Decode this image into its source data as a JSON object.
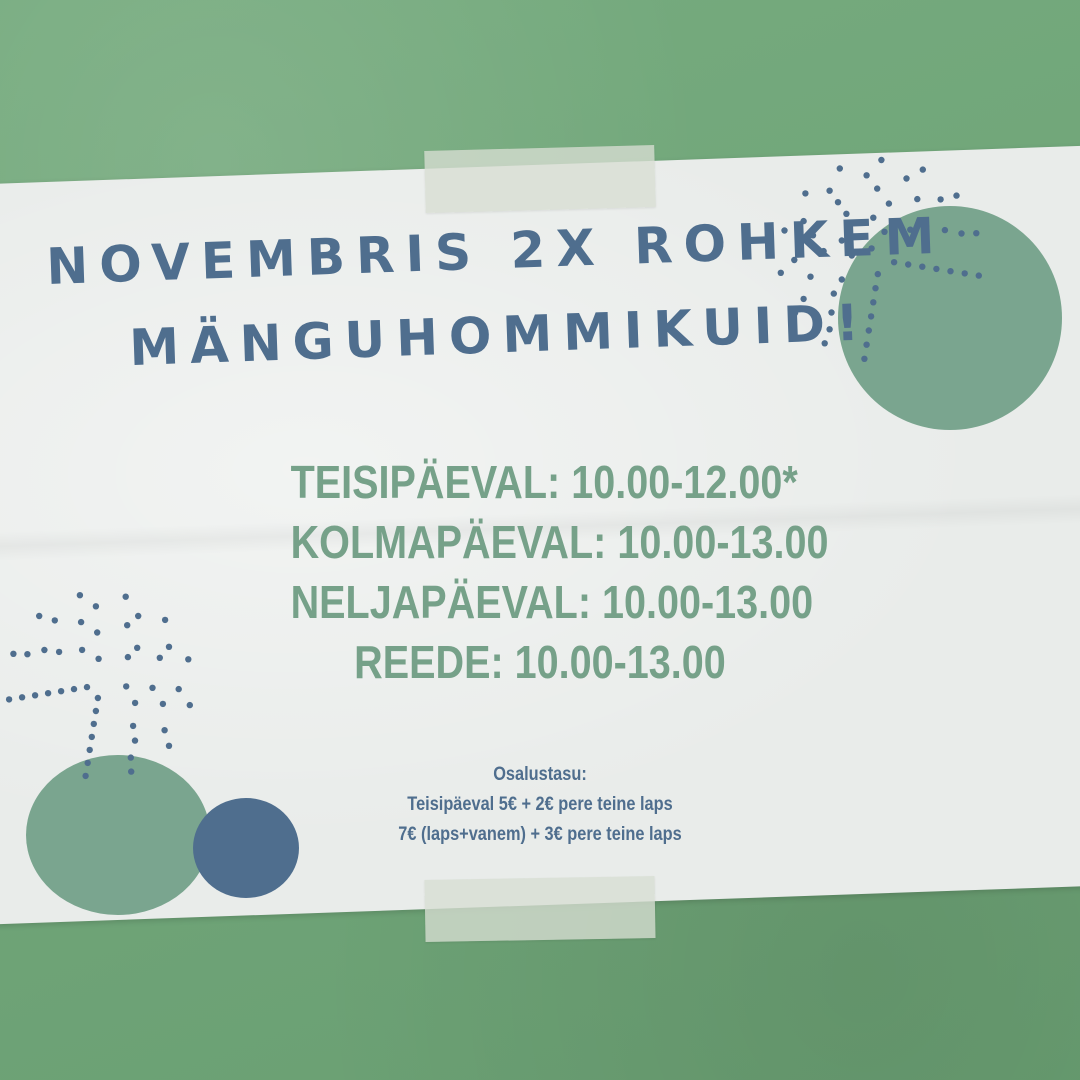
{
  "title": {
    "line1": "NOVEMBRIS 2X ROHKEM",
    "line2": "MÄNGUHOMMIKUID!"
  },
  "schedule": [
    "TEISIPÄEVAL: 10.00-12.00*",
    "KOLMAPÄEVAL: 10.00-13.00",
    "NELJAPÄEVAL: 10.00-13.00",
    "REEDE: 10.00-13.00"
  ],
  "fees": {
    "heading": "Osalustasu:",
    "line1": "Teisipäeval 5€ + 2€ pere teine laps",
    "line2": "7€ (laps+vanem) + 3€ pere teine laps"
  },
  "colors": {
    "background": "#6fa778",
    "paper": "#e9ecea",
    "title_blue": "#4f6e8e",
    "schedule_green": "#76a189",
    "circle_green": "#7aa58f",
    "circle_blue": "#4f6e8e"
  }
}
